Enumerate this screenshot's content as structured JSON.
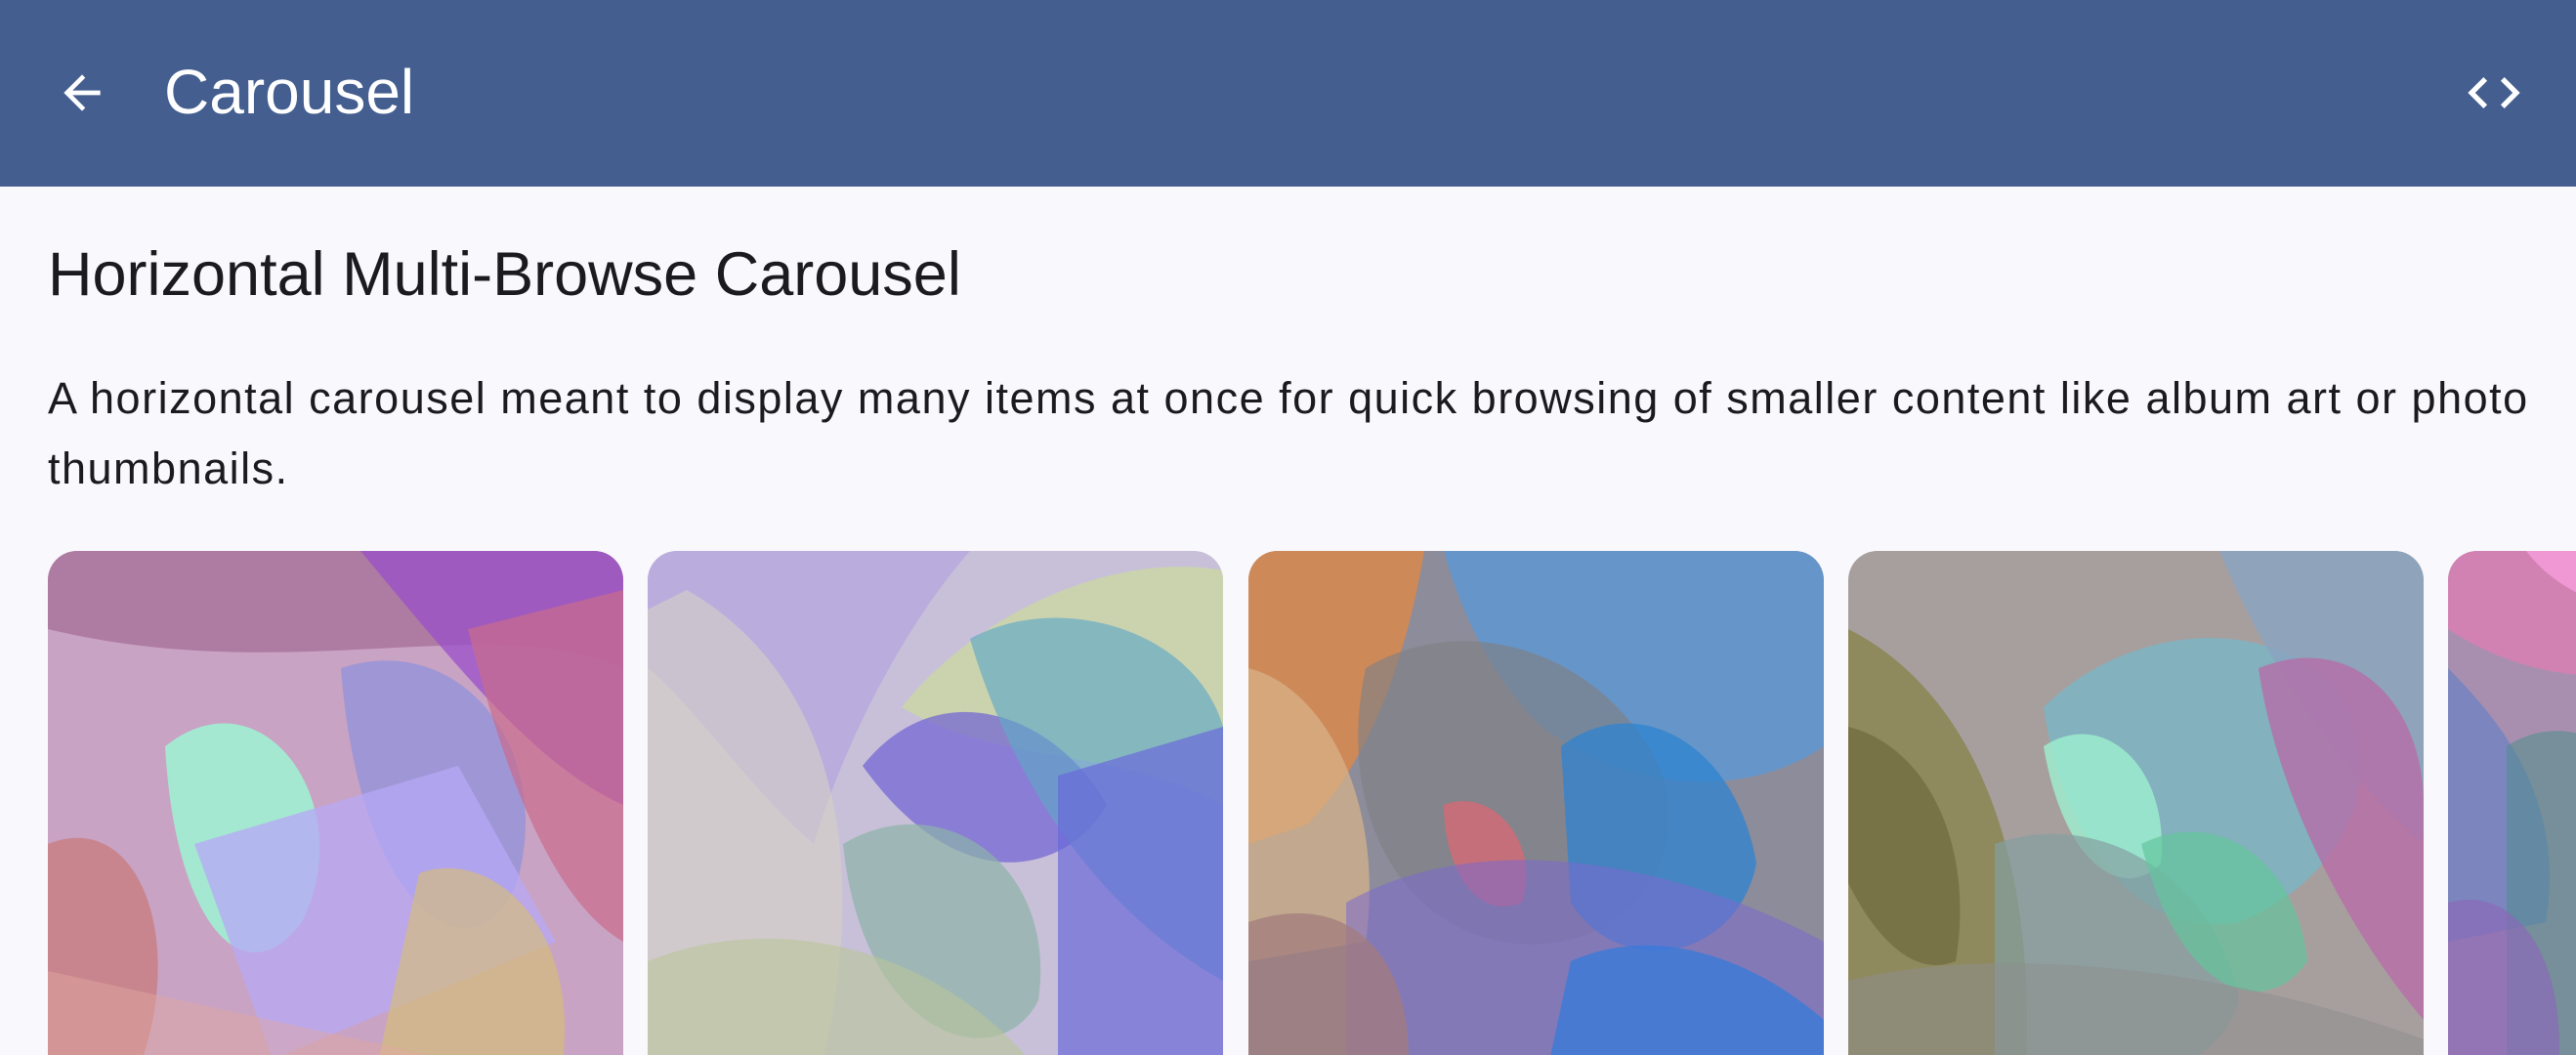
{
  "top_bar": {
    "title": "Carousel",
    "back_icon": "arrow-back-icon",
    "code_icon": "code-icon",
    "background_color": "#445e8f"
  },
  "section": {
    "title": "Horizontal Multi-Browse Carousel",
    "description": "A horizontal carousel meant to display many items at once for quick browsing of smaller content like album art or photo thumbnails."
  },
  "carousel": {
    "items": [
      {
        "image": "abstract-image-1"
      },
      {
        "image": "abstract-image-2"
      },
      {
        "image": "abstract-image-3"
      },
      {
        "image": "abstract-image-4"
      },
      {
        "image": "abstract-image-5"
      }
    ]
  }
}
